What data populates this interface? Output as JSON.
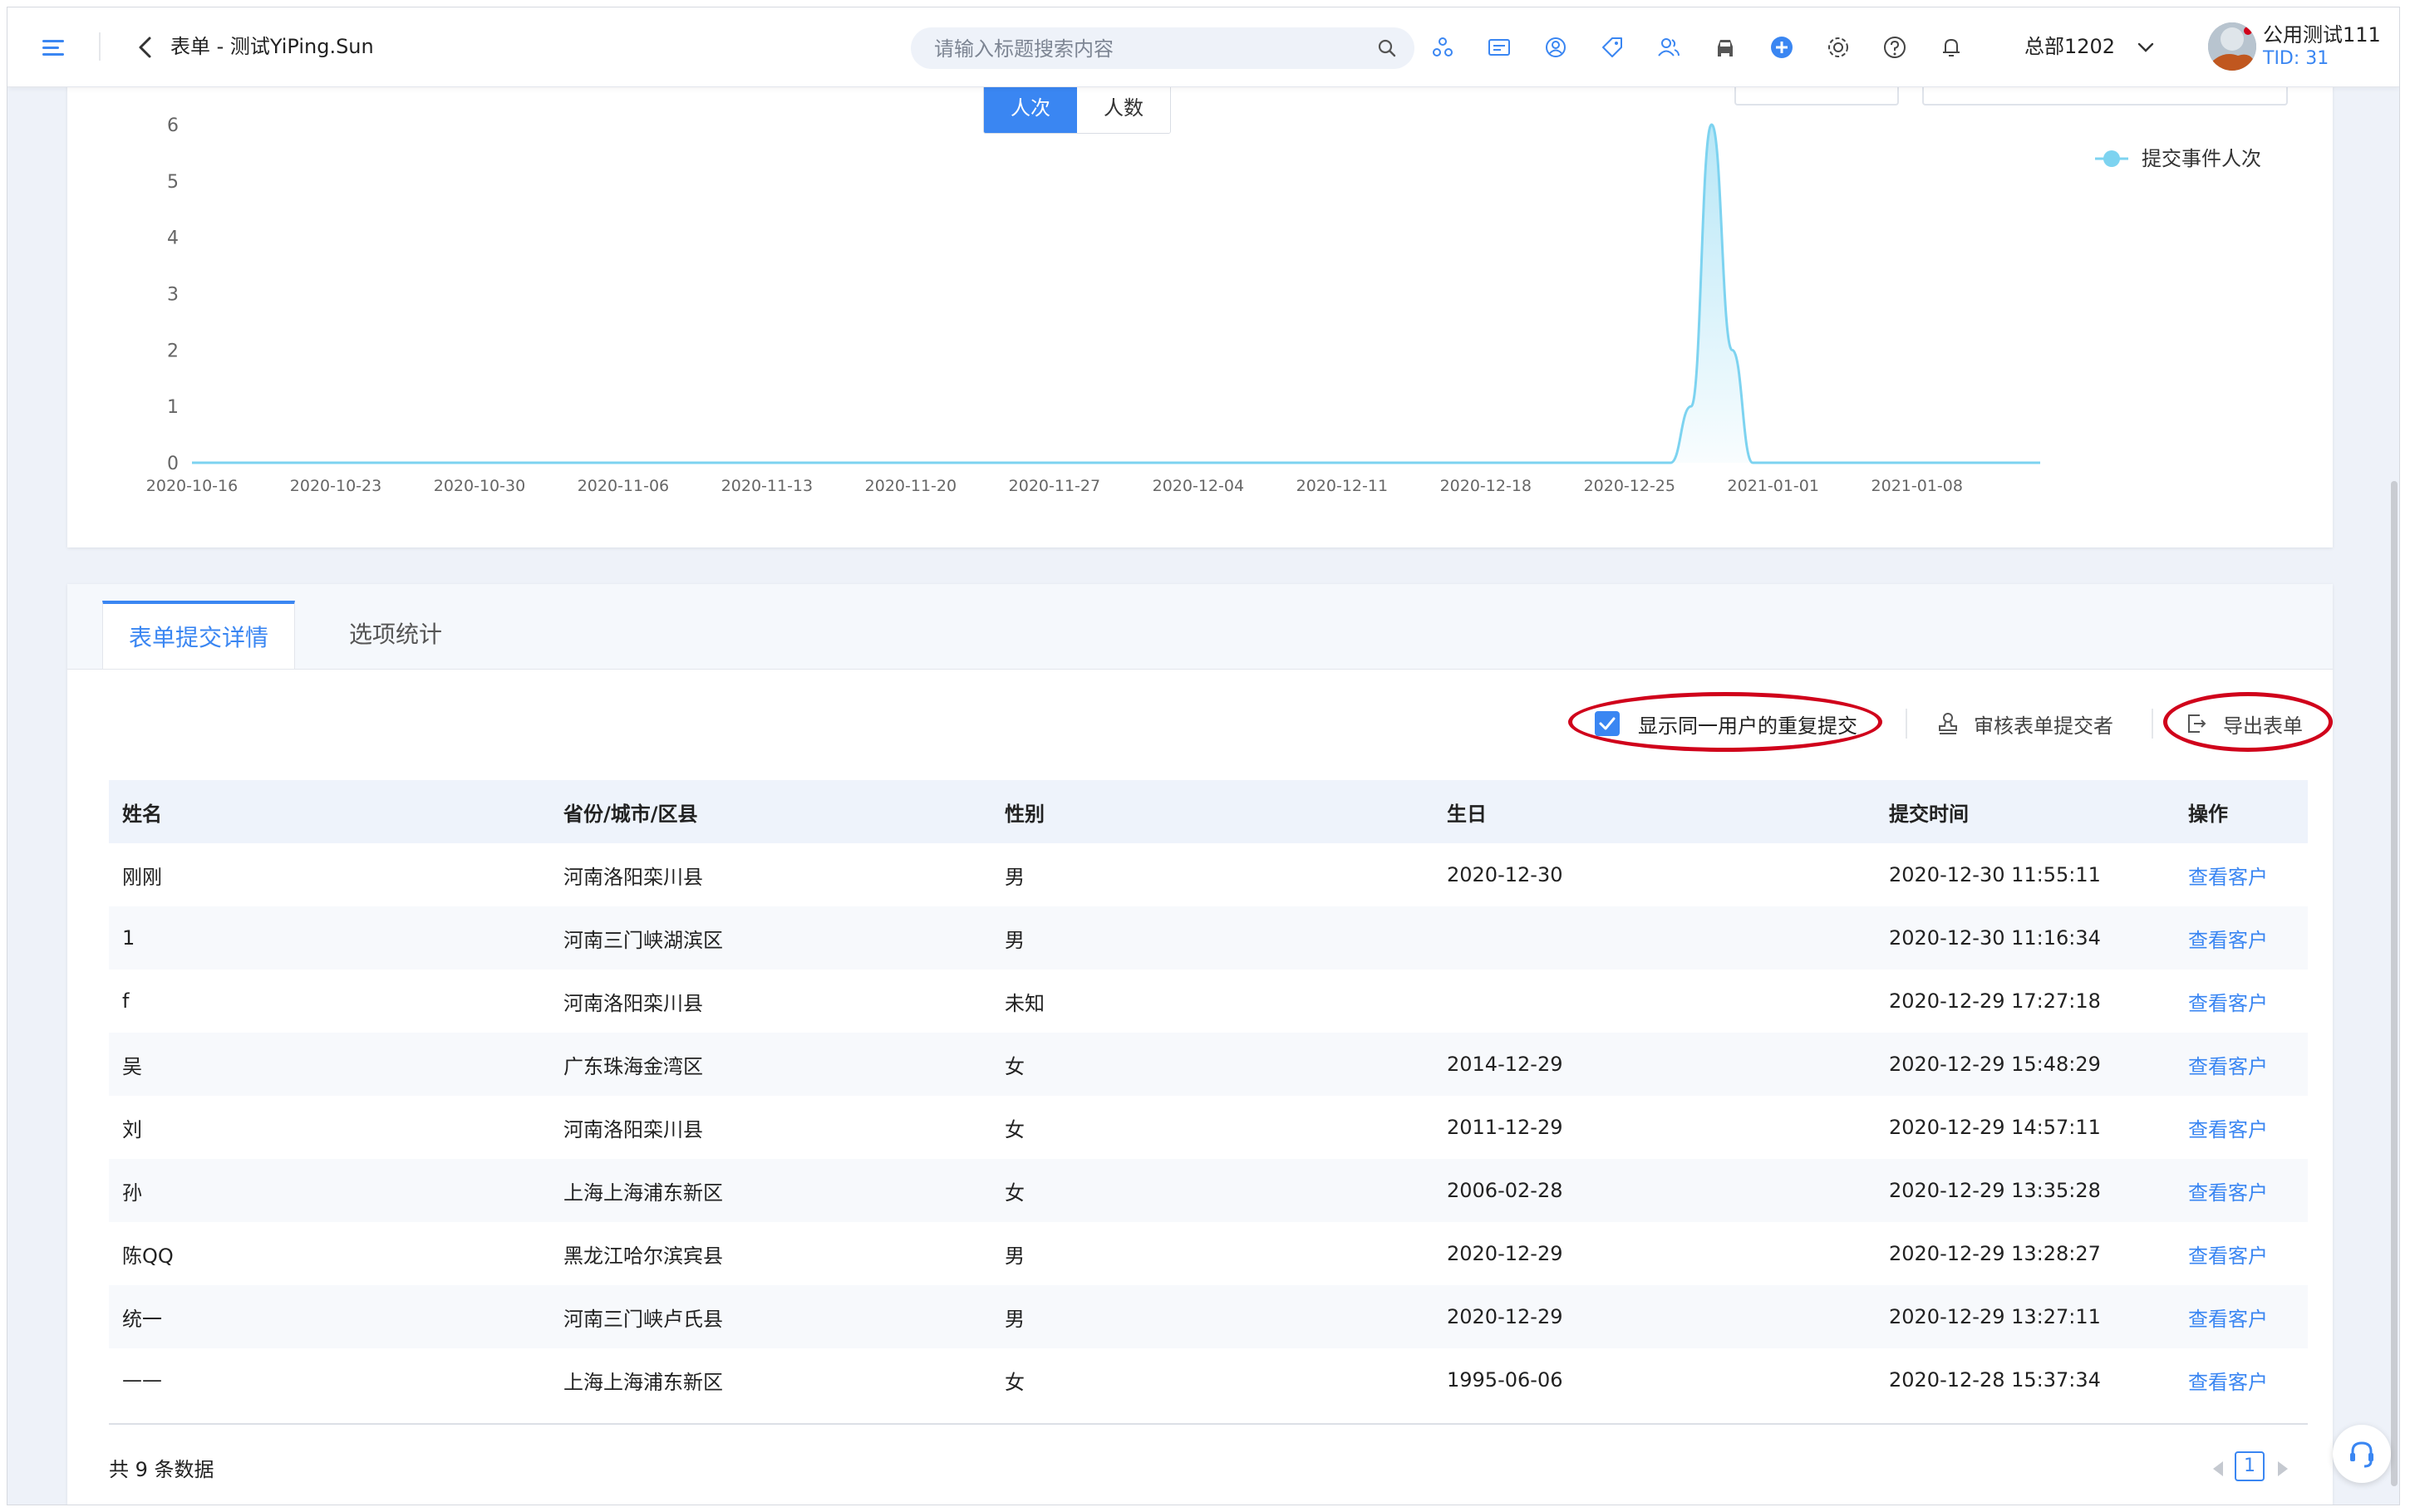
{
  "header": {
    "page_title": "表单 - 测试YiPing.Sun",
    "search_placeholder": "请输入标题搜索内容",
    "org_label": "总部1202",
    "user_name": "公用测试111",
    "user_tid": "TID: 31",
    "icons": [
      "menu-icon",
      "back-icon",
      "search-icon",
      "share-icon",
      "message-icon",
      "user-circle-icon",
      "tag-icon",
      "users-icon",
      "car-icon",
      "add-circle-icon",
      "gear-icon",
      "help-icon",
      "bell-icon",
      "chevron-down-icon"
    ]
  },
  "chart": {
    "toggle": {
      "active": "人次",
      "inactive": "人数"
    },
    "accent_color": "#3a86f2",
    "line_color": "#7dd3f0"
  },
  "chart_data": {
    "type": "area",
    "x": [
      "2020-10-16",
      "2020-10-17",
      "2020-10-18",
      "2020-10-19",
      "2020-10-20",
      "2020-10-21",
      "2020-10-22",
      "2020-10-23",
      "2020-10-24",
      "2020-10-25",
      "2020-10-26",
      "2020-10-27",
      "2020-10-28",
      "2020-10-29",
      "2020-10-30",
      "2020-10-31",
      "2020-11-01",
      "2020-11-02",
      "2020-11-03",
      "2020-11-04",
      "2020-11-05",
      "2020-11-06",
      "2020-11-07",
      "2020-11-08",
      "2020-11-09",
      "2020-11-10",
      "2020-11-11",
      "2020-11-12",
      "2020-11-13",
      "2020-11-14",
      "2020-11-15",
      "2020-11-16",
      "2020-11-17",
      "2020-11-18",
      "2020-11-19",
      "2020-11-20",
      "2020-11-21",
      "2020-11-22",
      "2020-11-23",
      "2020-11-24",
      "2020-11-25",
      "2020-11-26",
      "2020-11-27",
      "2020-11-28",
      "2020-11-29",
      "2020-11-30",
      "2020-12-01",
      "2020-12-02",
      "2020-12-03",
      "2020-12-04",
      "2020-12-05",
      "2020-12-06",
      "2020-12-07",
      "2020-12-08",
      "2020-12-09",
      "2020-12-10",
      "2020-12-11",
      "2020-12-12",
      "2020-12-13",
      "2020-12-14",
      "2020-12-15",
      "2020-12-16",
      "2020-12-17",
      "2020-12-18",
      "2020-12-19",
      "2020-12-20",
      "2020-12-21",
      "2020-12-22",
      "2020-12-23",
      "2020-12-24",
      "2020-12-25",
      "2020-12-26",
      "2020-12-27",
      "2020-12-28",
      "2020-12-29",
      "2020-12-30",
      "2020-12-31",
      "2021-01-01",
      "2021-01-02",
      "2021-01-03",
      "2021-01-04",
      "2021-01-05",
      "2021-01-06",
      "2021-01-07",
      "2021-01-08",
      "2021-01-09",
      "2021-01-10",
      "2021-01-11",
      "2021-01-12",
      "2021-01-13",
      "2021-01-14"
    ],
    "series": [
      {
        "name": "提交事件人次",
        "values": [
          0,
          0,
          0,
          0,
          0,
          0,
          0,
          0,
          0,
          0,
          0,
          0,
          0,
          0,
          0,
          0,
          0,
          0,
          0,
          0,
          0,
          0,
          0,
          0,
          0,
          0,
          0,
          0,
          0,
          0,
          0,
          0,
          0,
          0,
          0,
          0,
          0,
          0,
          0,
          0,
          0,
          0,
          0,
          0,
          0,
          0,
          0,
          0,
          0,
          0,
          0,
          0,
          0,
          0,
          0,
          0,
          0,
          0,
          0,
          0,
          0,
          0,
          0,
          0,
          0,
          0,
          0,
          0,
          0,
          0,
          0,
          0,
          0,
          1,
          6,
          2,
          0,
          0,
          0,
          0,
          0,
          0,
          0,
          0,
          0,
          0,
          0,
          0,
          0,
          0,
          0
        ]
      }
    ],
    "x_ticks": [
      "2020-10-16",
      "2020-10-23",
      "2020-10-30",
      "2020-11-06",
      "2020-11-13",
      "2020-11-20",
      "2020-11-27",
      "2020-12-04",
      "2020-12-11",
      "2020-12-18",
      "2020-12-25",
      "2021-01-01",
      "2021-01-08"
    ],
    "y_ticks": [
      "0",
      "1",
      "2",
      "3",
      "4",
      "5",
      "6"
    ],
    "ylim": [
      0,
      6
    ],
    "legend_position": "top-right"
  },
  "tabs": [
    "表单提交详情",
    "选项统计"
  ],
  "toolbar": {
    "repeat_label": "显示同一用户的重复提交",
    "repeat_checked": true,
    "audit_label": "审核表单提交者",
    "export_label": "导出表单"
  },
  "table": {
    "columns": [
      "姓名",
      "省份/城市/区县",
      "性别",
      "生日",
      "提交时间",
      "操作"
    ],
    "rows": [
      [
        "刚刚",
        "河南洛阳栾川县",
        "男",
        "2020-12-30",
        "2020-12-30 11:55:11",
        "查看客户"
      ],
      [
        "1",
        "河南三门峡湖滨区",
        "男",
        "",
        "2020-12-30 11:16:34",
        "查看客户"
      ],
      [
        "f",
        "河南洛阳栾川县",
        "未知",
        "",
        "2020-12-29 17:27:18",
        "查看客户"
      ],
      [
        "吴",
        "广东珠海金湾区",
        "女",
        "2014-12-29",
        "2020-12-29 15:48:29",
        "查看客户"
      ],
      [
        "刘",
        "河南洛阳栾川县",
        "女",
        "2011-12-29",
        "2020-12-29 14:57:11",
        "查看客户"
      ],
      [
        "孙",
        "上海上海浦东新区",
        "女",
        "2006-02-28",
        "2020-12-29 13:35:28",
        "查看客户"
      ],
      [
        "陈QQ",
        "黑龙江哈尔滨宾县",
        "男",
        "2020-12-29",
        "2020-12-29 13:28:27",
        "查看客户"
      ],
      [
        "统一",
        "河南三门峡卢氏县",
        "男",
        "2020-12-29",
        "2020-12-29 13:27:11",
        "查看客户"
      ],
      [
        "——",
        "上海上海浦东新区",
        "女",
        "1995-06-06",
        "2020-12-28 15:37:34",
        "查看客户"
      ]
    ],
    "total_label": "共 9 条数据",
    "current_page": "1"
  }
}
